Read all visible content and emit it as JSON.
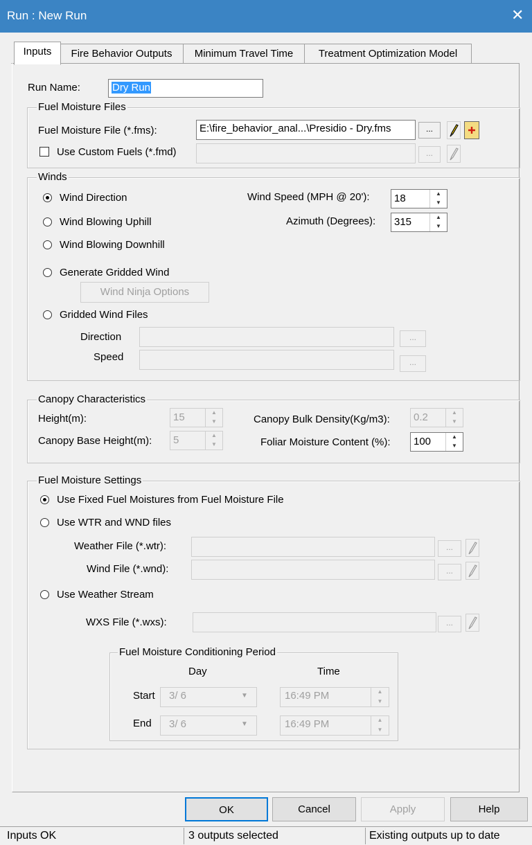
{
  "window": {
    "title": "Run : New Run",
    "close_icon": "close-icon"
  },
  "tabs": [
    "Inputs",
    "Fire Behavior Outputs",
    "Minimum Travel Time",
    "Treatment Optimization Model"
  ],
  "run_name": {
    "label": "Run Name:",
    "value": "Dry Run"
  },
  "fuel_moisture_files": {
    "title": "Fuel Moisture Files",
    "fms_label": "Fuel Moisture File (*.fms):",
    "fms_value": "E:\\fire_behavior_anal...\\Presidio - Dry.fms",
    "browse_label": "...",
    "custom_fuels_label": "Use Custom Fuels (*.fmd)",
    "custom_fuels_checked": false,
    "custom_fuels_value": ""
  },
  "winds": {
    "title": "Winds",
    "options": [
      "Wind Direction",
      "Wind Blowing Uphill",
      "Wind Blowing Downhill",
      "Generate Gridded Wind",
      "Gridded Wind Files"
    ],
    "selected": "Wind Direction",
    "wind_speed_label": "Wind Speed (MPH @ 20'):",
    "wind_speed_value": "18",
    "azimuth_label": "Azimuth (Degrees):",
    "azimuth_value": "315",
    "wind_ninja_button": "Wind Ninja Options",
    "direction_label": "Direction",
    "speed_label": "Speed",
    "browse_label": "..."
  },
  "canopy": {
    "title": "Canopy Characteristics",
    "height_label": "Height(m):",
    "height_value": "15",
    "base_height_label": "Canopy Base Height(m):",
    "base_height_value": "5",
    "bulk_density_label": "Canopy Bulk Density(Kg/m3):",
    "bulk_density_value": "0.2",
    "foliar_label": "Foliar Moisture Content (%):",
    "foliar_value": "100"
  },
  "fuel_moisture_settings": {
    "title": "Fuel Moisture Settings",
    "options": [
      "Use Fixed Fuel Moistures from Fuel Moisture File",
      "Use WTR and WND files",
      "Use Weather Stream"
    ],
    "selected": "Use Fixed Fuel Moistures from Fuel Moisture File",
    "weather_file_label": "Weather File (*.wtr):",
    "wind_file_label": "Wind File (*.wnd):",
    "wxs_file_label": "WXS File (*.wxs):",
    "browse_label": "...",
    "conditioning": {
      "title": "Fuel Moisture Conditioning Period",
      "day_header": "Day",
      "time_header": "Time",
      "start_label": "Start",
      "end_label": "End",
      "start_day": "3/ 6",
      "start_time": "16:49 PM",
      "end_day": "3/ 6",
      "end_time": "16:49 PM"
    }
  },
  "buttons": {
    "ok": "OK",
    "cancel": "Cancel",
    "apply": "Apply",
    "help": "Help"
  },
  "status": {
    "left": "Inputs OK",
    "middle": "3 outputs selected",
    "right": "Existing outputs up to date"
  },
  "colors": {
    "titlebar": "#3b84c4",
    "selection": "#3399ff",
    "pencil_yellow": "#f5d000",
    "plus_red": "#d02010"
  }
}
